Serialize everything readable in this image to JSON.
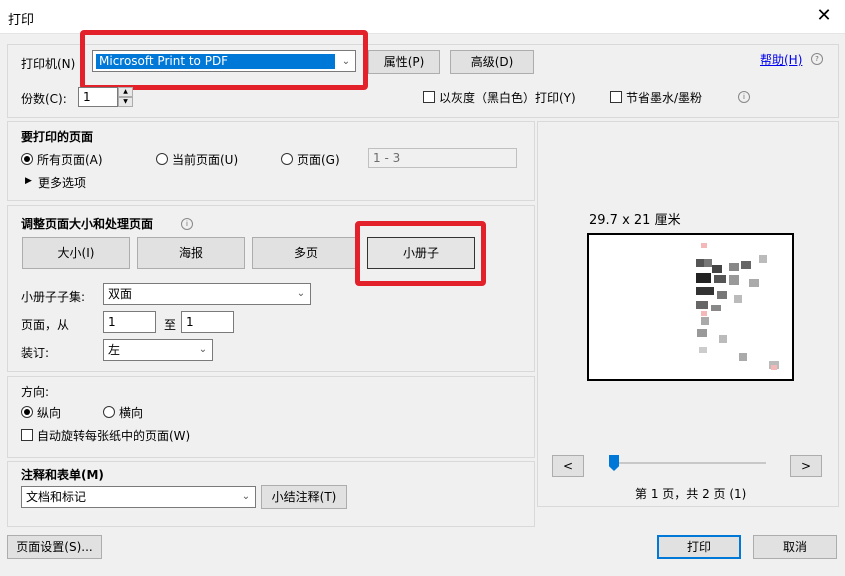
{
  "window": {
    "title": "打印"
  },
  "printer": {
    "label": "打印机(N)",
    "selected": "Microsoft Print to PDF",
    "properties_label": "属性(P)",
    "advanced_label": "高级(D)",
    "help_label": "帮助(H)",
    "copies_label": "份数(C):",
    "copies_value": "1",
    "grayscale_label": "以灰度（黑白色）打印(Y)",
    "save_ink_label": "节省墨水/墨粉"
  },
  "pages_to_print": {
    "heading": "要打印的页面",
    "all_label": "所有页面(A)",
    "current_label": "当前页面(U)",
    "pages_label": "页面(G)",
    "pages_placeholder": "1 - 3",
    "more_options_label": "更多选项"
  },
  "sizing": {
    "heading": "调整页面大小和处理页面",
    "tabs": [
      "大小(I)",
      "海报",
      "多页",
      "小册子"
    ],
    "booklet_subset_label": "小册子子集:",
    "booklet_subset_value": "双面",
    "pages_from_label": "页面，从",
    "pages_from_value": "1",
    "pages_to_label": "至",
    "pages_to_value": "1",
    "binding_label": "装订:",
    "binding_value": "左"
  },
  "orientation": {
    "heading": "方向:",
    "portrait_label": "纵向",
    "landscape_label": "横向",
    "auto_rotate_label": "自动旋转每张纸中的页面(W)"
  },
  "comments": {
    "heading": "注释和表单(M)",
    "value": "文档和标记",
    "summarize_label": "小结注释(T)"
  },
  "preview": {
    "size_label": "29.7 x 21 厘米",
    "prev_label": "<",
    "next_label": ">",
    "page_info": "第 1 页，共 2 页 (1)"
  },
  "footer": {
    "page_setup_label": "页面设置(S)...",
    "print_label": "打印",
    "cancel_label": "取消"
  },
  "state": {
    "selected_page_range": "all",
    "selected_sizing_tab": 3,
    "orientation": "portrait",
    "grayscale_checked": false,
    "save_ink_checked": false,
    "auto_rotate_checked": false,
    "slider_position": 0
  }
}
